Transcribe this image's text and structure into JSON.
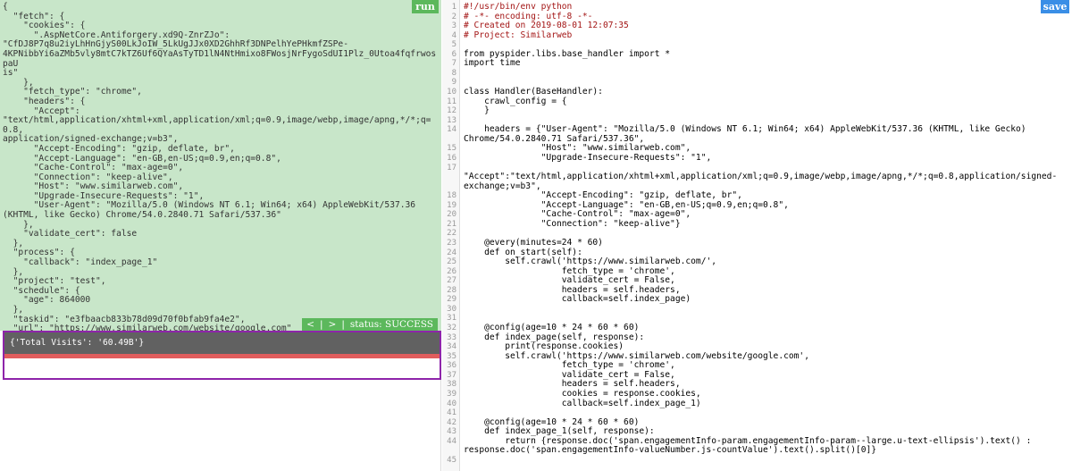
{
  "left": {
    "run_label": "run",
    "task_lines": [
      "{",
      "  \"fetch\": {",
      "    \"cookies\": {",
      "      \".AspNetCore.Antiforgery.xd9Q-ZnrZJo\":",
      "\"CfDJ8P7q8u2iyLhHnGjyS00LkJoIW_5LkUgJJx0XD2GhhRf3DNPelhYePHkmfZSPe-",
      "4KPNibbYi6aZMb5vly8mtC7kTZ6Uf6QYaAsTyTD1lN4NtHmixo8FWosjNrFygoSdUI1Plz_0Utoa4fqfrwospaU",
      "is\"",
      "    },",
      "    \"fetch_type\": \"chrome\",",
      "    \"headers\": {",
      "      \"Accept\":",
      "\"text/html,application/xhtml+xml,application/xml;q=0.9,image/webp,image/apng,*/*;q=0.8,",
      "application/signed-exchange;v=b3\",",
      "      \"Accept-Encoding\": \"gzip, deflate, br\",",
      "      \"Accept-Language\": \"en-GB,en-US;q=0.9,en;q=0.8\",",
      "      \"Cache-Control\": \"max-age=0\",",
      "      \"Connection\": \"keep-alive\",",
      "      \"Host\": \"www.similarweb.com\",",
      "      \"Upgrade-Insecure-Requests\": \"1\",",
      "      \"User-Agent\": \"Mozilla/5.0 (Windows NT 6.1; Win64; x64) AppleWebKit/537.36",
      "(KHTML, like Gecko) Chrome/54.0.2840.71 Safari/537.36\"",
      "    },",
      "    \"validate_cert\": false",
      "  },",
      "  \"process\": {",
      "    \"callback\": \"index_page_1\"",
      "  },",
      "  \"project\": \"test\",",
      "  \"schedule\": {",
      "    \"age\": 864000",
      "  },",
      "  \"taskid\": \"e3fbaacb833b78d09d70f0bfab9fa4e2\",",
      "  \"url\": \"https://www.similarweb.com/website/google.com\"",
      "}"
    ],
    "status": {
      "prev": "<",
      "sep1": "|",
      "next": ">",
      "sep2": "|",
      "text": "status: SUCCESS"
    },
    "result_text": "{'Total Visits': '60.49B'}"
  },
  "right": {
    "save_label": "save",
    "lines": [
      {
        "n": "1",
        "t": "#!/usr/bin/env python"
      },
      {
        "n": "2",
        "t": "# -*- encoding: utf-8 -*-"
      },
      {
        "n": "3",
        "t": "# Created on 2019-08-01 12:07:35"
      },
      {
        "n": "4",
        "t": "# Project: Similarweb"
      },
      {
        "n": "5",
        "t": ""
      },
      {
        "n": "6",
        "t": "from pyspider.libs.base_handler import *"
      },
      {
        "n": "7",
        "t": "import time"
      },
      {
        "n": "8",
        "t": ""
      },
      {
        "n": "9",
        "t": ""
      },
      {
        "n": "10",
        "t": "class Handler(BaseHandler):"
      },
      {
        "n": "11",
        "t": "    crawl_config = {"
      },
      {
        "n": "12",
        "t": "    }"
      },
      {
        "n": "13",
        "t": ""
      },
      {
        "n": "14",
        "t": "    headers = {\"User-Agent\": \"Mozilla/5.0 (Windows NT 6.1; Win64; x64) AppleWebKit/537.36 (KHTML, like Gecko)"
      },
      {
        "n": "",
        "t": "Chrome/54.0.2840.71 Safari/537.36\","
      },
      {
        "n": "15",
        "t": "               \"Host\": \"www.similarweb.com\","
      },
      {
        "n": "16",
        "t": "               \"Upgrade-Insecure-Requests\": \"1\","
      },
      {
        "n": "17",
        "t": ""
      },
      {
        "n": "",
        "t": "\"Accept\":\"text/html,application/xhtml+xml,application/xml;q=0.9,image/webp,image/apng,*/*;q=0.8,application/signed-"
      },
      {
        "n": "",
        "t": "exchange;v=b3\","
      },
      {
        "n": "18",
        "t": "               \"Accept-Encoding\": \"gzip, deflate, br\","
      },
      {
        "n": "19",
        "t": "               \"Accept-Language\": \"en-GB,en-US;q=0.9,en;q=0.8\","
      },
      {
        "n": "20",
        "t": "               \"Cache-Control\": \"max-age=0\","
      },
      {
        "n": "21",
        "t": "               \"Connection\": \"keep-alive\"}"
      },
      {
        "n": "22",
        "t": ""
      },
      {
        "n": "23",
        "t": "    @every(minutes=24 * 60)"
      },
      {
        "n": "24",
        "t": "    def on_start(self):"
      },
      {
        "n": "25",
        "t": "        self.crawl('https://www.similarweb.com/',"
      },
      {
        "n": "26",
        "t": "                   fetch_type = 'chrome',"
      },
      {
        "n": "27",
        "t": "                   validate_cert = False,"
      },
      {
        "n": "28",
        "t": "                   headers = self.headers,"
      },
      {
        "n": "29",
        "t": "                   callback=self.index_page)"
      },
      {
        "n": "30",
        "t": ""
      },
      {
        "n": "31",
        "t": ""
      },
      {
        "n": "32",
        "t": "    @config(age=10 * 24 * 60 * 60)"
      },
      {
        "n": "33",
        "t": "    def index_page(self, response):"
      },
      {
        "n": "34",
        "t": "        print(response.cookies)"
      },
      {
        "n": "35",
        "t": "        self.crawl('https://www.similarweb.com/website/google.com',"
      },
      {
        "n": "36",
        "t": "                   fetch_type = 'chrome',"
      },
      {
        "n": "37",
        "t": "                   validate_cert = False,"
      },
      {
        "n": "38",
        "t": "                   headers = self.headers,"
      },
      {
        "n": "39",
        "t": "                   cookies = response.cookies,"
      },
      {
        "n": "40",
        "t": "                   callback=self.index_page_1)"
      },
      {
        "n": "41",
        "t": ""
      },
      {
        "n": "42",
        "t": "    @config(age=10 * 24 * 60 * 60)"
      },
      {
        "n": "43",
        "t": "    def index_page_1(self, response):"
      },
      {
        "n": "44",
        "t": "        return {response.doc('span.engagementInfo-param.engagementInfo-param--large.u-text-ellipsis').text() :"
      },
      {
        "n": "",
        "t": "response.doc('span.engagementInfo-valueNumber.js-countValue').text().split()[0]}"
      },
      {
        "n": "45",
        "t": ""
      }
    ]
  }
}
